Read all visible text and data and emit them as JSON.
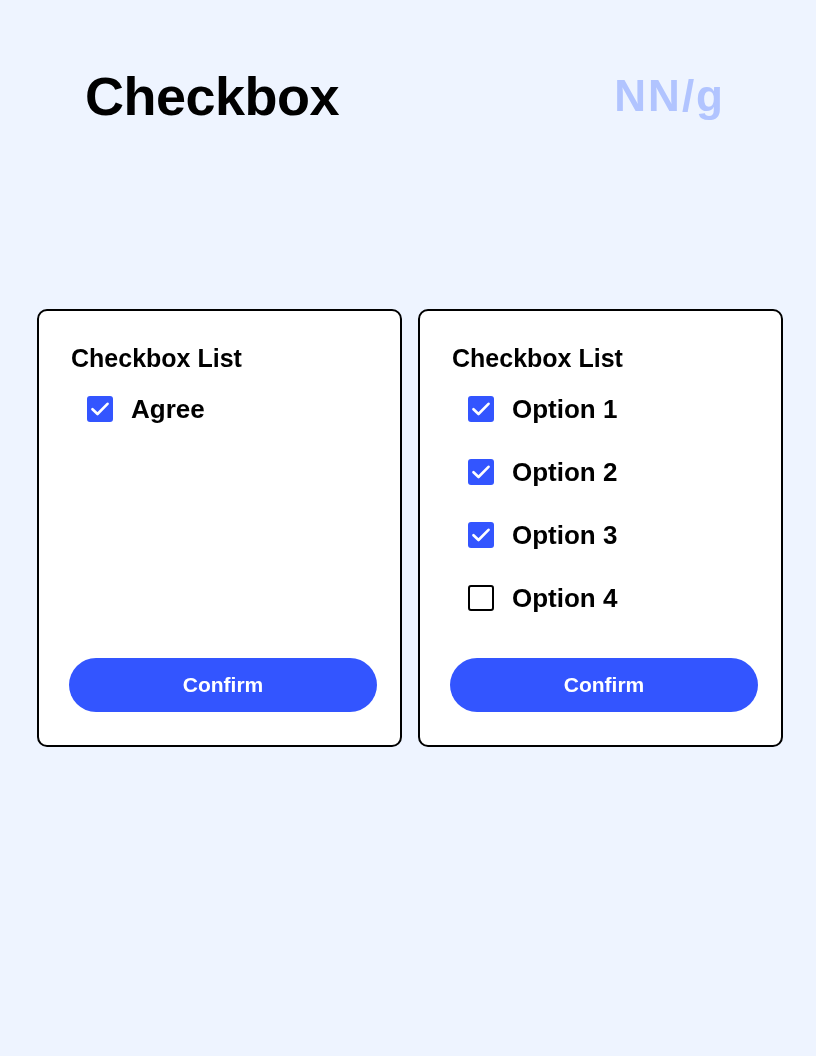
{
  "header": {
    "title": "Checkbox",
    "logo": "NN/g"
  },
  "cards": [
    {
      "title": "Checkbox List",
      "options": [
        {
          "label": "Agree",
          "checked": true
        }
      ],
      "button": "Confirm"
    },
    {
      "title": "Checkbox List",
      "options": [
        {
          "label": "Option 1",
          "checked": true
        },
        {
          "label": "Option 2",
          "checked": true
        },
        {
          "label": "Option 3",
          "checked": true
        },
        {
          "label": "Option 4",
          "checked": false
        }
      ],
      "button": "Confirm"
    }
  ]
}
